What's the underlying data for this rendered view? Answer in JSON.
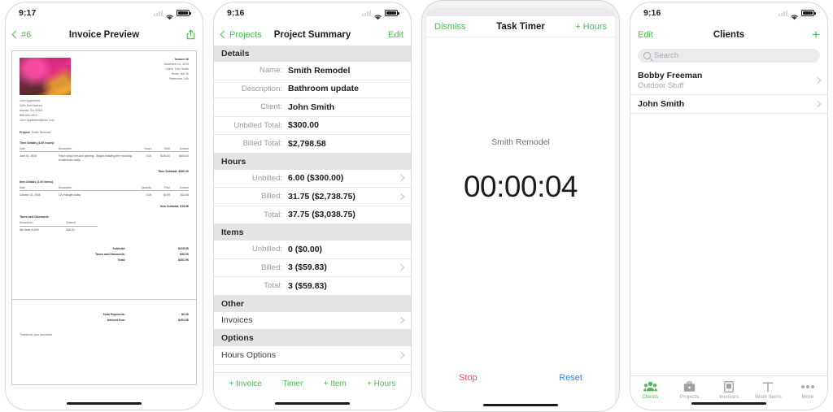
{
  "accent_green": "#4cbb52",
  "stop_red": "#e8555f",
  "reset_blue": "#3a86d6",
  "phones": [
    {
      "status": {
        "time": "9:17",
        "wifi": "wifi-icon",
        "battery": "battery-icon",
        "signal": "signal-icon"
      },
      "nav": {
        "back_label": "#6",
        "title": "Invoice Preview",
        "action_icon": "share-icon"
      },
      "invoice": {
        "meta": [
          {
            "text": "Invoice #6",
            "bold": true
          },
          {
            "text": "November 01, 2019",
            "bold": false
          },
          {
            "text": "Client: John Smith",
            "bold": false
          },
          {
            "text": "Terms: Net 30",
            "bold": false
          },
          {
            "text": "Reference: N/A",
            "bold": false
          }
        ],
        "address": [
          "John Appleseed",
          "3494 Kuhl Avenue",
          "Atlanta, GA 30303",
          "888-555-0012",
          "John.Appleseed@mac.com"
        ],
        "project_label": "Project:",
        "project_value": "Smith Remodel",
        "time_details_heading": "Time Details (4.00 hours)",
        "time_columns": [
          "Date",
          "Description",
          "Hours",
          "Rate",
          "Amount"
        ],
        "time_rows": [
          {
            "date": "June 02, 2008",
            "description": "Finish Wood trim and painting - Began installing trim moulding to bathroom vanity",
            "hours": "4.00",
            "rate": "$100.00",
            "amount": "$400.00"
          }
        ],
        "time_subtotal": "Time Subtotal: $400.00",
        "item_details_heading": "Item Details (1.00 items)",
        "item_columns": [
          "Date",
          "Description",
          "Quantity",
          "Price",
          "Amount"
        ],
        "item_rows": [
          {
            "date": "October 15, 2008",
            "description": "12v Halogen bulbs",
            "quantity": "4.00",
            "price": "$3.99",
            "amount": "$15.96"
          }
        ],
        "item_subtotal": "Item Subtotal: $15.96",
        "taxes_heading": "Taxes and Discounts",
        "tax_columns": [
          "Description",
          "Amount"
        ],
        "tax_rows": [
          {
            "description": "WA State 8.00%",
            "amount": "$36.00"
          }
        ],
        "totals": [
          {
            "label": "Subtotal:",
            "value": "$415.96"
          },
          {
            "label": "Taxes and Discounts:",
            "value": "$36.00"
          },
          {
            "label": "Total:",
            "value": "$451.96"
          }
        ],
        "payments": [
          {
            "label": "Total Payments:",
            "value": "$0.00"
          },
          {
            "label": "Amount Due:",
            "value": "$451.96"
          }
        ],
        "thanks": "Thanks for your business!"
      }
    },
    {
      "status": {
        "time": "9:16"
      },
      "nav": {
        "back_label": "Projects",
        "title": "Project Summary",
        "action_label": "Edit"
      },
      "sections": [
        {
          "header": "Details",
          "rows": [
            {
              "label": "Name:",
              "value": "Smith Remodel",
              "chevron": false
            },
            {
              "label": "Description:",
              "value": "Bathroom update",
              "chevron": false
            },
            {
              "label": "Client:",
              "value": "John Smith",
              "chevron": false
            },
            {
              "label": "Unbilled Total:",
              "value": "$300.00",
              "chevron": false
            },
            {
              "label": "Billed Total:",
              "value": "$2,798.58",
              "chevron": false
            }
          ]
        },
        {
          "header": "Hours",
          "rows": [
            {
              "label": "Unbilled:",
              "value": "6.00  ($300.00)",
              "chevron": true
            },
            {
              "label": "Billed:",
              "value": "31.75  ($2,738.75)",
              "chevron": true
            },
            {
              "label": "Total:",
              "value": "37.75  ($3,038.75)",
              "chevron": false
            }
          ]
        },
        {
          "header": "Items",
          "rows": [
            {
              "label": "Unbilled:",
              "value": "0 ($0.00)",
              "chevron": false
            },
            {
              "label": "Billed:",
              "value": "3  ($59.83)",
              "chevron": true
            },
            {
              "label": "Total:",
              "value": "3  ($59.83)",
              "chevron": false
            }
          ]
        },
        {
          "header": "Other",
          "rows": [
            {
              "label": "",
              "value": "Invoices",
              "chevron": true,
              "plain": true
            }
          ]
        },
        {
          "header": "Options",
          "rows": [
            {
              "label": "",
              "value": "Hours Options",
              "chevron": true,
              "plain": true
            }
          ]
        }
      ],
      "toolbar": [
        "+ Invoice",
        "Timer",
        "+ Item",
        "+ Hours"
      ]
    },
    {
      "sheet_nav": {
        "dismiss_label": "Dismiss",
        "title": "Task Timer",
        "action_label": "+ Hours"
      },
      "timer": {
        "project": "Smith Remodel",
        "value": "00:00:04",
        "stop_label": "Stop",
        "reset_label": "Reset"
      }
    },
    {
      "status": {
        "time": "9:16"
      },
      "nav": {
        "left_label": "Edit",
        "title": "Clients",
        "action_icon": "plus-icon"
      },
      "search": {
        "placeholder": "Search",
        "icon": "search-icon"
      },
      "clients": [
        {
          "name": "Bobby Freeman",
          "subtitle": "Outdoor Stuff"
        },
        {
          "name": "John Smith",
          "subtitle": ""
        }
      ],
      "tabs": [
        {
          "label": "Clients",
          "icon": "clients-icon",
          "active": true
        },
        {
          "label": "Projects",
          "icon": "briefcase-icon",
          "active": false
        },
        {
          "label": "Invoices",
          "icon": "document-icon",
          "active": false
        },
        {
          "label": "Work Items",
          "icon": "hammer-icon",
          "active": false
        },
        {
          "label": "More",
          "icon": "ellipsis-icon",
          "active": false
        }
      ]
    }
  ]
}
